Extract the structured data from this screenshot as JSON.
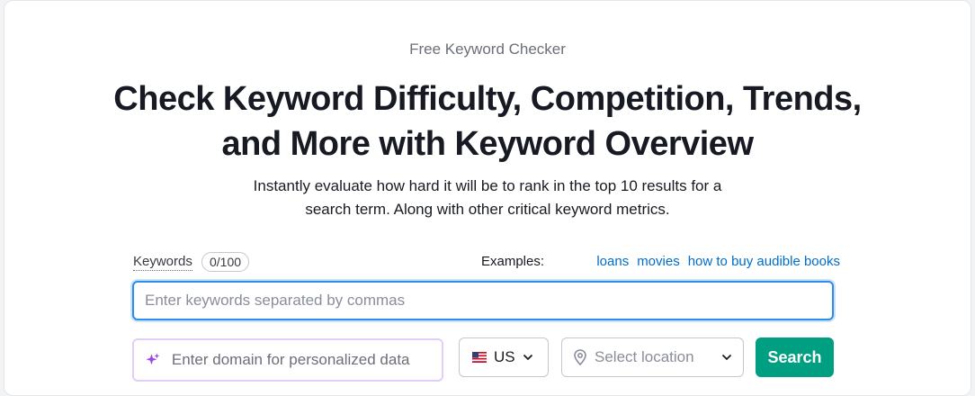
{
  "hero": {
    "eyebrow": "Free Keyword Checker",
    "title_line1": "Check Keyword Difficulty, Competition, Trends,",
    "title_line2": "and More with Keyword Overview",
    "subtitle_line1": "Instantly evaluate how hard it will be to rank in the top 10 results for a",
    "subtitle_line2": "search term. Along with other critical keyword metrics."
  },
  "form": {
    "keywords_label": "Keywords",
    "keywords_counter": "0/100",
    "examples_label": "Examples:",
    "examples": [
      "loans",
      "movies",
      "how to buy audible books"
    ],
    "keywords_placeholder": "Enter keywords separated by commas",
    "keywords_value": "",
    "domain_placeholder": "Enter domain for personalized data",
    "domain_value": "",
    "country_label": "US",
    "country_flag": "us-flag-icon",
    "location_placeholder": "Select location",
    "search_label": "Search"
  },
  "colors": {
    "accent_blue": "#2d8de8",
    "link": "#006dca",
    "search_button": "#009f81",
    "ai_purple": "#9a48e8"
  }
}
